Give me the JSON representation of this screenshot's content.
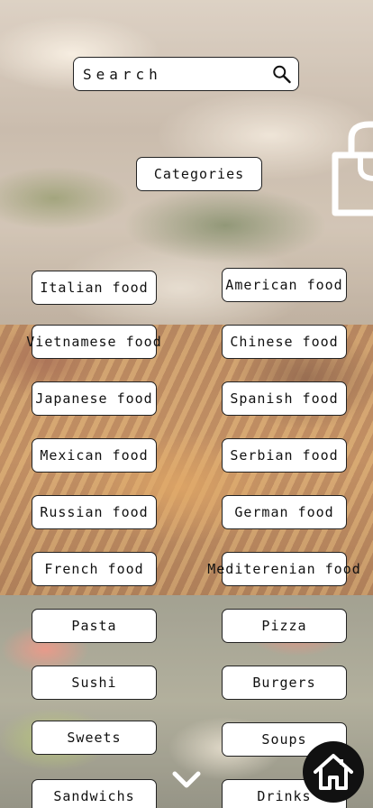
{
  "search": {
    "placeholder": "Search"
  },
  "header": {
    "categories_label": "Categories"
  },
  "categories": [
    "Italian food",
    "American food",
    "Vietnamese food",
    "Chinese food",
    "Japanese food",
    "Spanish food",
    "Mexican food",
    "Serbian food",
    "Russian food",
    "German food",
    "French food",
    "Mediterenian food",
    "Pasta",
    "Pizza",
    "Sushi",
    "Burgers",
    "Sweets",
    "Soups",
    "Sandwichs",
    "Drinks"
  ],
  "icons": {
    "search": "search-icon",
    "bag": "shopping-bag-icon",
    "more": "chevron-down-icon",
    "home": "home-icon"
  },
  "colors": {
    "button_bg": "#ffffff",
    "border": "#222222",
    "home_bg": "#111111"
  }
}
